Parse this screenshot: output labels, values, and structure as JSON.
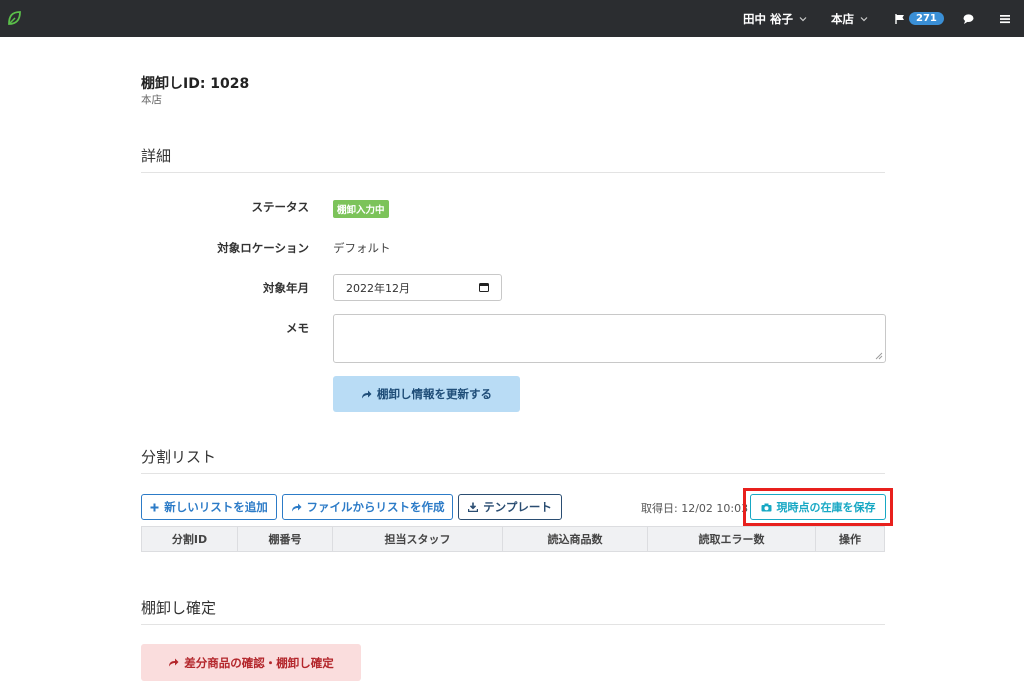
{
  "navbar": {
    "user_name": "田中 裕子",
    "store_name": "本店",
    "notification_count": "271"
  },
  "header": {
    "title": "棚卸しID: 1028",
    "subtitle": "本店"
  },
  "details": {
    "section_title": "詳細",
    "status_label": "ステータス",
    "status_value": "棚卸入力中",
    "location_label": "対象ロケーション",
    "location_value": "デフォルト",
    "month_label": "対象年月",
    "month_value": "2022年12月",
    "memo_label": "メモ",
    "memo_value": "",
    "update_button": "棚卸し情報を更新する"
  },
  "split_list": {
    "section_title": "分割リスト",
    "add_button": "新しいリストを追加",
    "from_file_button": "ファイルからリストを作成",
    "template_button": "テンプレート",
    "fetch_date": "取得日: 12/02 10:03",
    "snapshot_button": "現時点の在庫を保存",
    "columns": [
      "分割ID",
      "棚番号",
      "担当スタッフ",
      "読込商品数",
      "読取エラー数",
      "操作"
    ]
  },
  "confirm": {
    "section_title": "棚卸し確定",
    "button": "差分商品の確認・棚卸し確定"
  },
  "colors": {
    "navbar_bg": "#2b2d30",
    "status_green": "#7cc35a",
    "primary_blue": "#2c7bc7",
    "info_cyan": "#17a8c4",
    "danger_light": "#fadddd",
    "highlight_red": "#e8201d"
  }
}
